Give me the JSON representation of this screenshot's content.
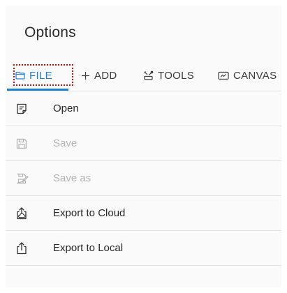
{
  "header": {
    "title": "Options"
  },
  "tabs": [
    {
      "label": "FILE",
      "icon": "folder-icon",
      "active": true
    },
    {
      "label": "ADD",
      "icon": "plus-icon",
      "active": false
    },
    {
      "label": "TOOLS",
      "icon": "tools-icon",
      "active": false
    },
    {
      "label": "CANVAS",
      "icon": "canvas-icon",
      "active": false
    }
  ],
  "menu": {
    "items": [
      {
        "label": "Open",
        "icon": "open-file-icon",
        "enabled": true
      },
      {
        "label": "Save",
        "icon": "save-icon",
        "enabled": false
      },
      {
        "label": "Save as",
        "icon": "save-as-icon",
        "enabled": false
      },
      {
        "label": "Export to Cloud",
        "icon": "export-cloud-icon",
        "enabled": true
      },
      {
        "label": "Export to Local",
        "icon": "export-local-icon",
        "enabled": true
      }
    ]
  },
  "colors": {
    "accent": "#1e7fd0",
    "focus_outline": "#d10f0f",
    "disabled_text": "#b3b3b3",
    "divider": "#e3e3e3",
    "panel_bg": "#fafafa"
  }
}
